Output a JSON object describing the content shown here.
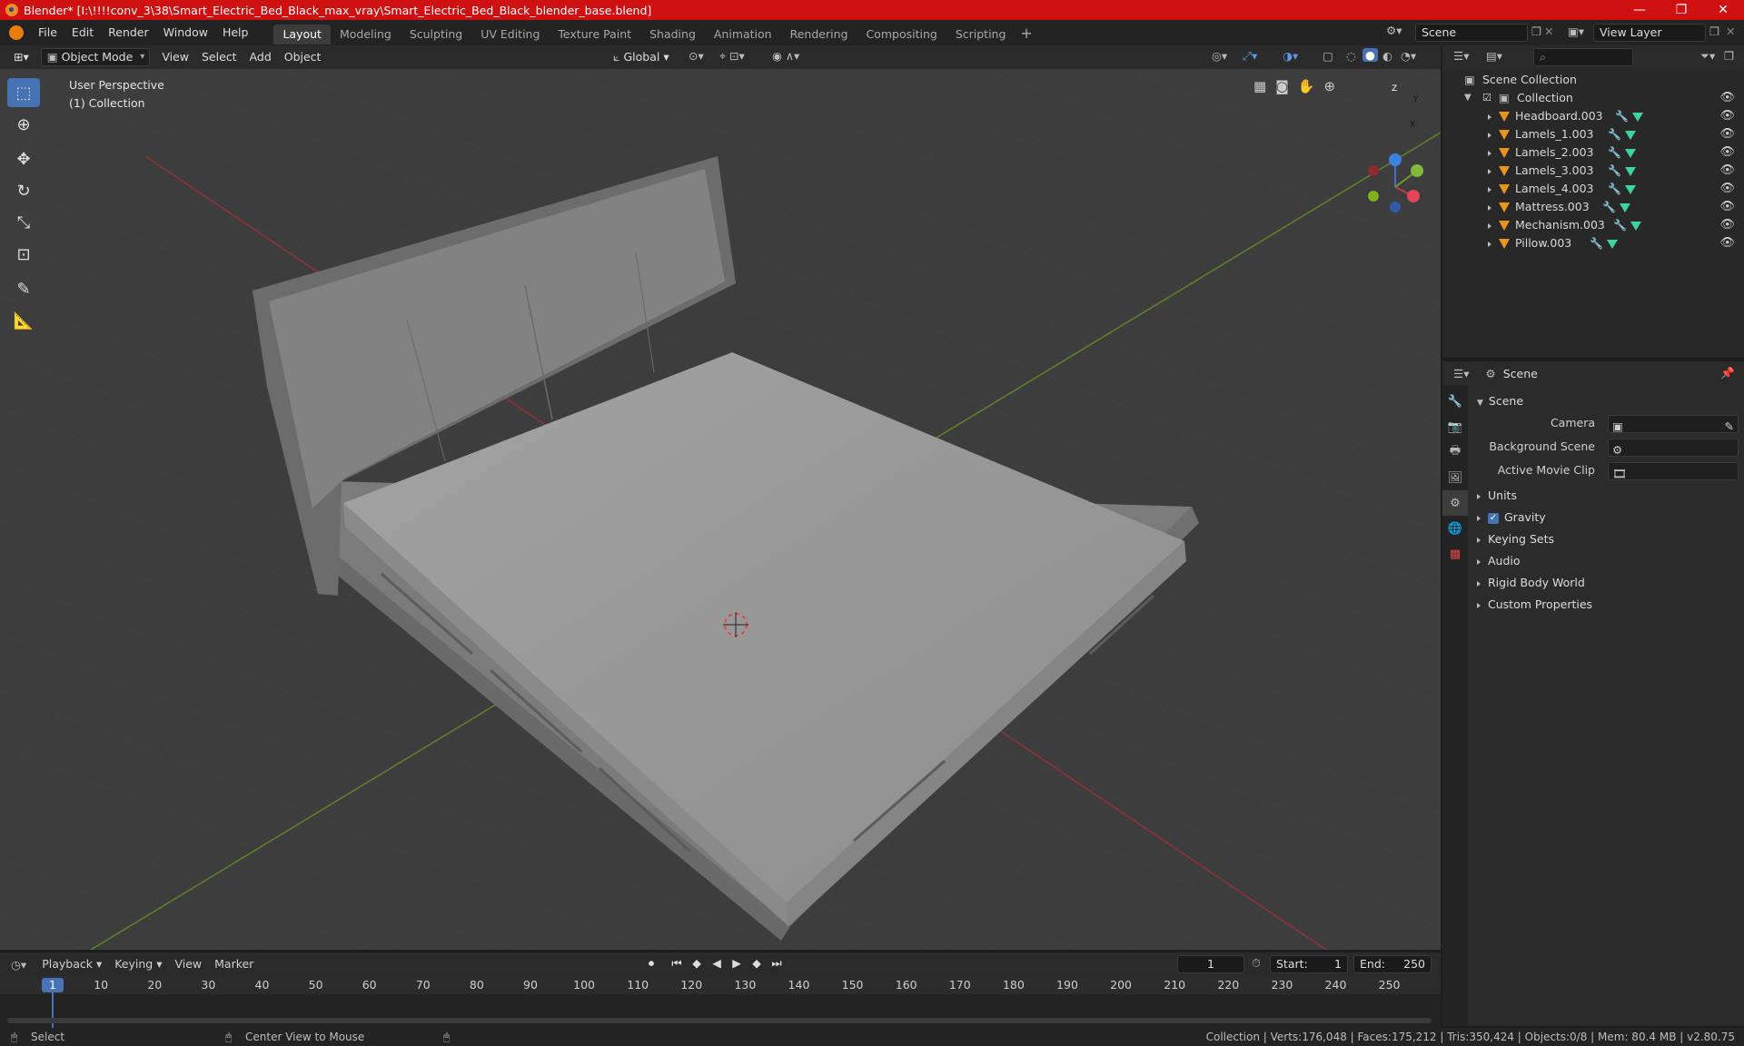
{
  "window": {
    "title": "Blender* [I:\\!!!!conv_3\\38\\Smart_Electric_Bed_Black_max_vray\\Smart_Electric_Bed_Black_blender_base.blend]",
    "controls": [
      "—",
      "❐",
      "✕"
    ]
  },
  "menu": [
    "File",
    "Edit",
    "Render",
    "Window",
    "Help"
  ],
  "workspaces": [
    "Layout",
    "Modeling",
    "Sculpting",
    "UV Editing",
    "Texture Paint",
    "Shading",
    "Animation",
    "Rendering",
    "Compositing",
    "Scripting"
  ],
  "active_workspace": "Layout",
  "scene_field": "Scene",
  "view_layer_field": "View Layer",
  "viewport_header": {
    "mode": "Object Mode",
    "menus": [
      "View",
      "Select",
      "Add",
      "Object"
    ],
    "transform_orientation": "Global"
  },
  "viewport": {
    "perspective_label": "User Perspective",
    "collection_label": "(1) Collection",
    "gizmo": {
      "x": "X",
      "y": "Y",
      "z": "Z"
    }
  },
  "outliner": {
    "root": "Scene Collection",
    "collection": "Collection",
    "objects": [
      "Headboard.003",
      "Lamels_1.003",
      "Lamels_2.003",
      "Lamels_3.003",
      "Lamels_4.003",
      "Mattress.003",
      "Mechanism.003",
      "Pillow.003"
    ]
  },
  "properties": {
    "context": "Scene",
    "panel_title": "Scene",
    "fields": [
      {
        "label": "Camera"
      },
      {
        "label": "Background Scene"
      },
      {
        "label": "Active Movie Clip"
      }
    ],
    "subpanels": [
      "Units",
      "Gravity",
      "Keying Sets",
      "Audio",
      "Rigid Body World",
      "Custom Properties"
    ],
    "gravity_checked": true
  },
  "timeline": {
    "menus": [
      "Playback",
      "Keying",
      "View",
      "Marker"
    ],
    "current_frame": "1",
    "start_label": "Start:",
    "start": "1",
    "end_label": "End:",
    "end": "250",
    "ticks": [
      "1",
      "10",
      "20",
      "30",
      "40",
      "50",
      "60",
      "70",
      "80",
      "90",
      "100",
      "110",
      "120",
      "130",
      "140",
      "150",
      "160",
      "170",
      "180",
      "190",
      "200",
      "210",
      "220",
      "230",
      "240",
      "250"
    ]
  },
  "statusbar": {
    "left_action": "Select",
    "middle_action": "Center View to Mouse",
    "stats": "Collection | Verts:176,048 | Faces:175,212 | Tris:350,424 | Objects:0/8 | Mem: 80.4 MB | v2.80.75"
  }
}
